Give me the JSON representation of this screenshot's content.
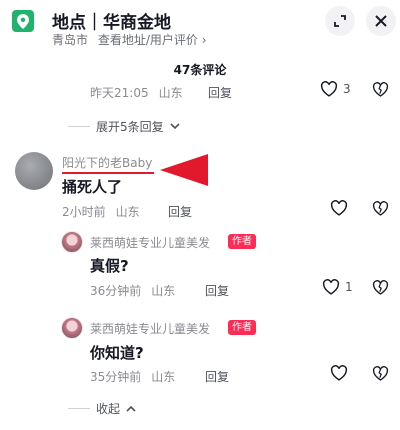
{
  "header": {
    "title": "地点｜华商金地",
    "city": "青岛市",
    "subtitle_link": "查看地址/用户评价 ›"
  },
  "comments_count": "47条评论",
  "prev_comment": {
    "time": "昨天21:05",
    "location": "山东",
    "reply_label": "回复",
    "likes": "3"
  },
  "expand_replies": "展开5条回复",
  "main_comment": {
    "author": "阳光下的老Baby",
    "text": "捅死人了",
    "time": "2小时前",
    "location": "山东",
    "reply_label": "回复"
  },
  "replies": [
    {
      "author": "莱西萌娃专业儿童美发",
      "tag": "作者",
      "text": "真假?",
      "time": "36分钟前",
      "location": "山东",
      "reply_label": "回复",
      "likes": "1"
    },
    {
      "author": "莱西萌娃专业儿童美发",
      "tag": "作者",
      "text": "你知道?",
      "time": "35分钟前",
      "location": "山东",
      "reply_label": "回复"
    }
  ],
  "collapse": "收起",
  "colors": {
    "accent": "#fe2c55",
    "location_badge": "#21b36b",
    "annotation": "#e2192c"
  }
}
